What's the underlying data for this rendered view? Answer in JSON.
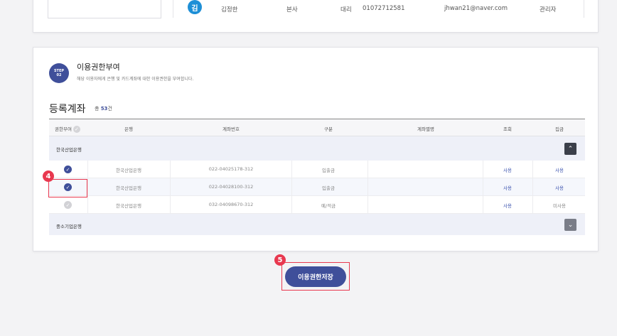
{
  "top_user_row": {
    "avatar": "김",
    "name": "김정한",
    "dept": "본사",
    "position": "대리",
    "phone": "01072712581",
    "email": "jhwan21@naver.com",
    "role": "관리자"
  },
  "step": {
    "badge_line1": "STEP",
    "badge_line2": "02",
    "title": "이용권한부여",
    "description": "해당 이용자에게 은행 및 카드계좌에 대한 이용권한을 부여합니다."
  },
  "section": {
    "title": "등록계좌",
    "count_prefix": "총",
    "count_value": "53",
    "count_suffix": "건"
  },
  "table": {
    "headers": {
      "grant": "권한부여",
      "bank": "은행",
      "account_no": "계좌번호",
      "type": "구분",
      "alias": "계좌별명",
      "inquiry": "조회",
      "collection": "집금"
    },
    "groups": [
      {
        "label": "한국산업은행",
        "rows": [
          {
            "checked": true,
            "bank": "한국산업은행",
            "account_no": "022-04025178-312",
            "type": "입출금",
            "alias": "",
            "inquiry": "사용",
            "collection": "사용"
          },
          {
            "checked": true,
            "bank": "한국산업은행",
            "account_no": "022-04028100-312",
            "type": "입출금",
            "alias": "",
            "inquiry": "사용",
            "collection": "사용"
          },
          {
            "checked": false,
            "bank": "한국산업은행",
            "account_no": "032-04098670-312",
            "type": "예/적금",
            "alias": "",
            "inquiry": "사용",
            "collection": "미사용"
          }
        ]
      },
      {
        "label": "중소기업은행",
        "rows": []
      }
    ]
  },
  "markers": {
    "step4": "4",
    "step5": "5"
  },
  "save_button_label": "이용권한저장",
  "colors": {
    "accent": "#3f4f9a",
    "marker": "#e8384f",
    "link": "#3f56b0",
    "avatar": "#1e8fd6"
  },
  "icons": {
    "check": "check-icon",
    "toggle_up": "chevron-up-icon",
    "toggle_down": "chevron-down-icon",
    "help": "question-icon"
  }
}
